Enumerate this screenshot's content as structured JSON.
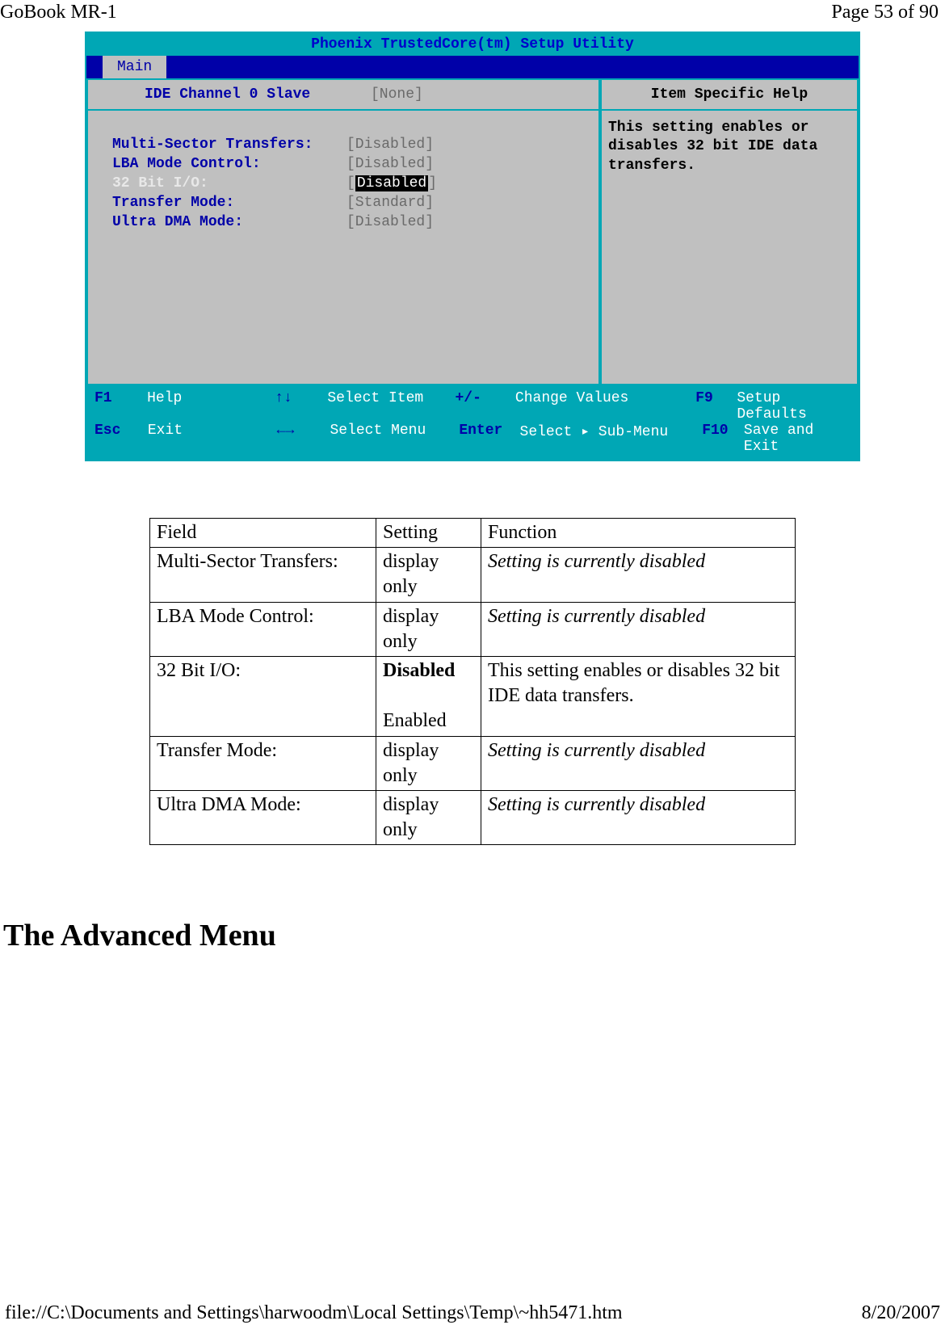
{
  "header": {
    "title": "GoBook MR-1",
    "page_of": "Page 53 of 90"
  },
  "bios": {
    "title": "Phoenix TrustedCore(tm) Setup Utility",
    "tab": "Main",
    "subhead_label": "IDE Channel 0 Slave",
    "subhead_value": "[None]",
    "help_header": "Item Specific Help",
    "help_text": "This setting enables or disables 32 bit IDE data transfers.",
    "rows": [
      {
        "label": "Multi-Sector Transfers:",
        "value": "[Disabled]",
        "selected": false
      },
      {
        "label": "LBA Mode Control:",
        "value": "[Disabled]",
        "selected": false
      },
      {
        "label": "32 Bit I/O:",
        "value_prefix": "[",
        "value_inner": "Disabled",
        "value_suffix": "]",
        "selected": true
      },
      {
        "label": "Transfer Mode:",
        "value": "[Standard]",
        "selected": false
      },
      {
        "label": "Ultra DMA Mode:",
        "value": "[Disabled]",
        "selected": false
      }
    ],
    "footer": {
      "r1": {
        "k1": "F1",
        "l1": "Help",
        "k2": "↑↓",
        "l2": "Select Item",
        "k3": "+/-",
        "l3": "Change Values",
        "k4": "F9",
        "l4": "Setup Defaults"
      },
      "r2": {
        "k1": "Esc",
        "l1": "Exit",
        "k2": "←→",
        "l2": "Select Menu",
        "k3": "Enter",
        "l3": "Select ▸ Sub-Menu",
        "k4": "F10",
        "l4": "Save and Exit"
      }
    }
  },
  "table": {
    "head": {
      "field": "Field",
      "setting": "Setting",
      "function": "Function"
    },
    "rows": [
      {
        "field": "Multi-Sector Transfers:",
        "setting": "display only",
        "function": "Setting is currently disabled",
        "function_italic": true
      },
      {
        "field": "LBA Mode Control:",
        "setting": "display only",
        "function": "Setting is currently disabled",
        "function_italic": true
      },
      {
        "field": "32 Bit I/O:",
        "setting_bold": "Disabled",
        "setting_plain": "Enabled",
        "function": "This setting enables or disables 32 bit IDE data transfers.",
        "function_italic": false
      },
      {
        "field": "Transfer Mode:",
        "setting": "display only",
        "function": "Setting is currently disabled",
        "function_italic": true
      },
      {
        "field": "Ultra DMA Mode:",
        "setting": "display only",
        "function": "Setting is currently disabled",
        "function_italic": true
      }
    ]
  },
  "section_heading": "The Advanced Menu",
  "footer": {
    "path": "file://C:\\Documents and Settings\\harwoodm\\Local Settings\\Temp\\~hh5471.htm",
    "date": "8/20/2007"
  }
}
